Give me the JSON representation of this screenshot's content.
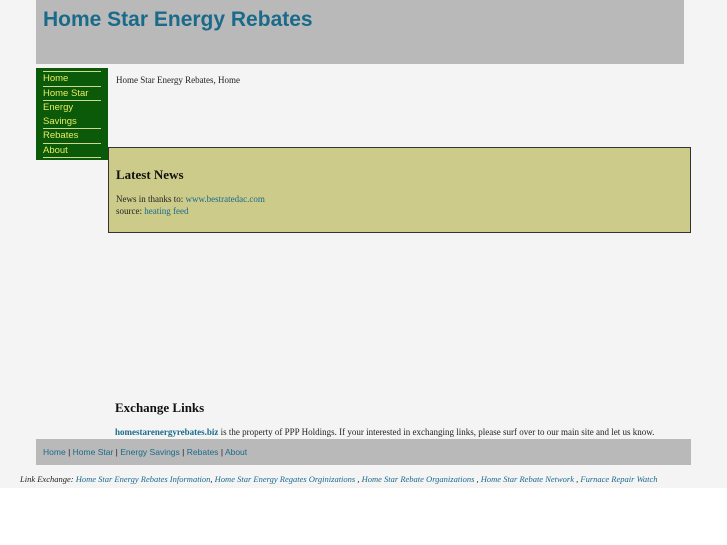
{
  "header": {
    "title": "Home Star Energy Rebates"
  },
  "sidebar": {
    "items": [
      {
        "label": "Home"
      },
      {
        "label": "Home Star"
      },
      {
        "label": "Energy Savings"
      },
      {
        "label": "Rebates"
      },
      {
        "label": "About"
      }
    ]
  },
  "breadcrumb": {
    "text": "Home Star Energy Rebates, Home"
  },
  "news": {
    "title": "Latest News",
    "thanks_prefix": "News in thanks to:",
    "thanks_link": "www.bestratedac.com",
    "source_prefix": "source:",
    "source_link": "heating feed"
  },
  "exchange": {
    "title": "Exchange Links",
    "site": "homestarenergyrebates.biz",
    "text": "is the property of PPP Holdings. If your interested in exchanging links, please surf over to our main site and let us know."
  },
  "footer_nav": {
    "items": [
      "Home",
      "Home Star",
      "Energy Savings",
      "Rebates",
      "About"
    ],
    "separator": "|"
  },
  "link_exchange": {
    "prefix": "Link Exchange:",
    "links": [
      "Home Star Energy Rebates Information",
      "Home Star Energy Regates Orginizations",
      "Home Star Rebate Organizations",
      "Home Star Rebate Network",
      "Furnace Repair Watch"
    ],
    "separator": ","
  }
}
